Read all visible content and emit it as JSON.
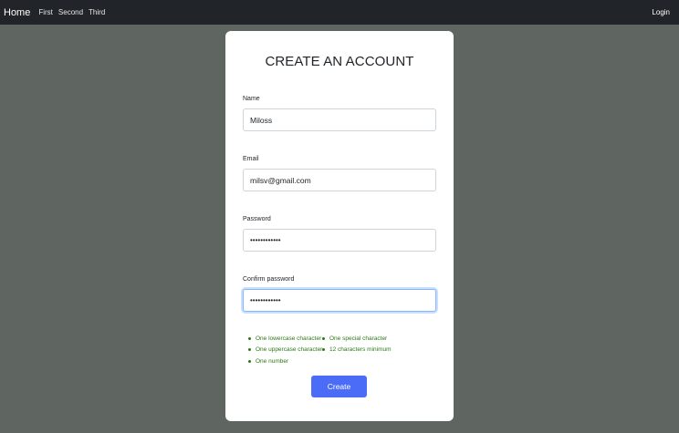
{
  "navbar": {
    "brand": "Home",
    "links": [
      "First",
      "Second",
      "Third"
    ],
    "login": "Login"
  },
  "form": {
    "title": "CREATE AN ACCOUNT",
    "fields": [
      {
        "label": "Name",
        "value": "Miloss",
        "type": "text"
      },
      {
        "label": "Email",
        "value": "milsv@gmail.com",
        "type": "email"
      },
      {
        "label": "Password",
        "value": "••••••••••••",
        "type": "password"
      },
      {
        "label": "Confirm password",
        "value": "••••••••••••",
        "type": "password"
      }
    ],
    "rules": [
      "One lowercase character",
      "One special character",
      "One uppercase character",
      "12 characters minimum",
      "One number"
    ],
    "submit_label": "Create"
  },
  "colors": {
    "background": "#5f6560",
    "navbar": "#212529",
    "button": "#4a6cf7",
    "rule_text": "#2a7a14"
  }
}
